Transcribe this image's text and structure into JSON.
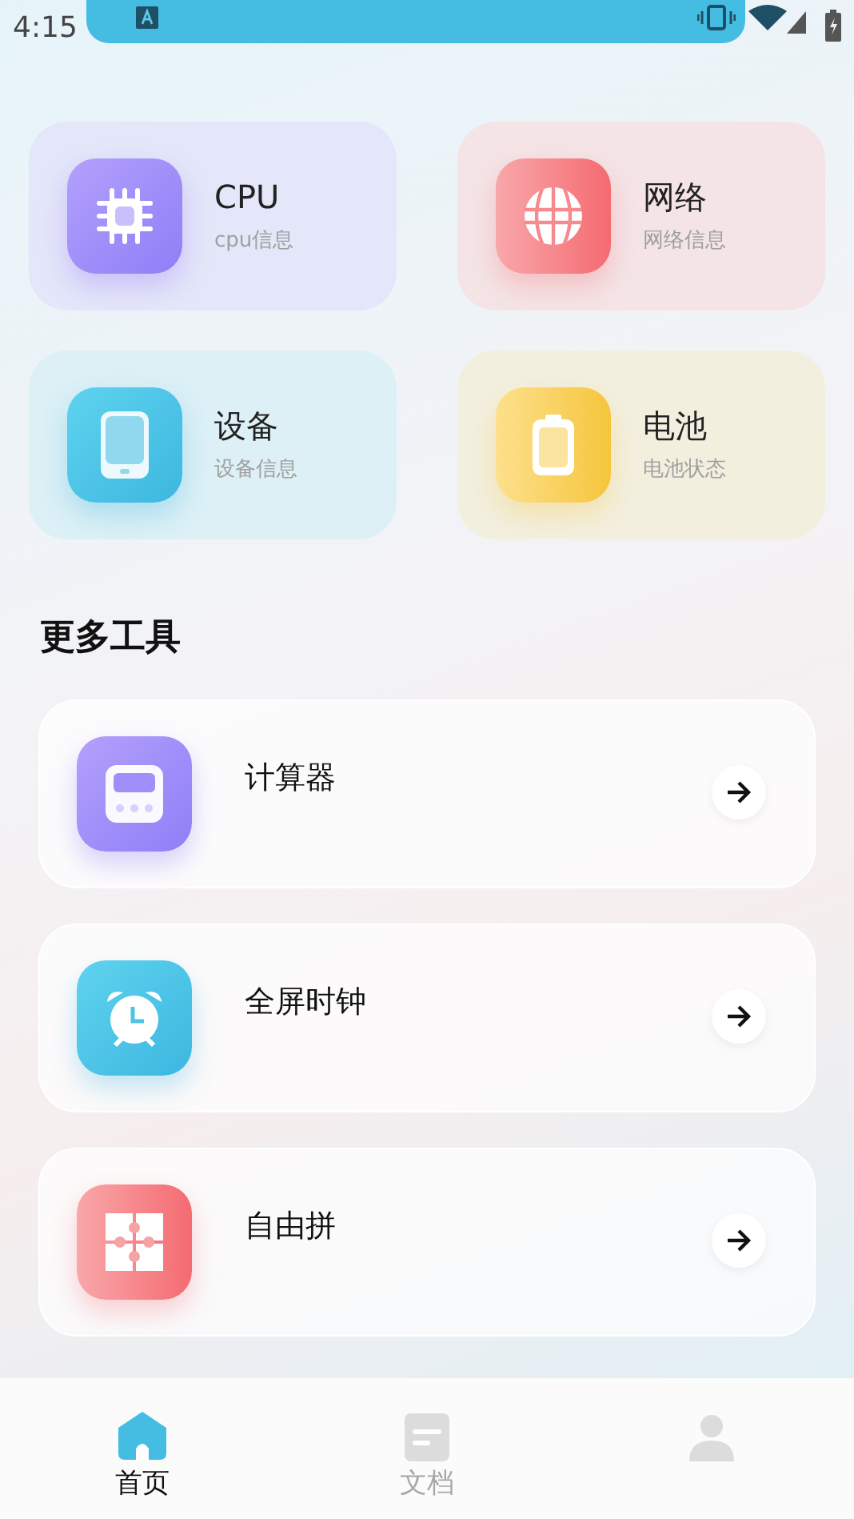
{
  "status_bar": {
    "time": "4:15"
  },
  "info_cards": [
    {
      "kind": "cpu",
      "title": "CPU",
      "subtitle": "cpu信息"
    },
    {
      "kind": "network",
      "title": "网络",
      "subtitle": "网络信息"
    },
    {
      "kind": "device",
      "title": "设备",
      "subtitle": "设备信息"
    },
    {
      "kind": "battery",
      "title": "电池",
      "subtitle": "电池状态"
    }
  ],
  "section_title": "更多工具",
  "tools": [
    {
      "kind": "calculator",
      "label": "计算器"
    },
    {
      "kind": "clock",
      "label": "全屏时钟"
    },
    {
      "kind": "puzzle",
      "label": "自由拼"
    }
  ],
  "bottom_nav": [
    {
      "kind": "home",
      "label": "首页",
      "selected": true
    },
    {
      "kind": "doc",
      "label": "文档",
      "selected": false
    },
    {
      "kind": "profile",
      "selected": false
    }
  ]
}
